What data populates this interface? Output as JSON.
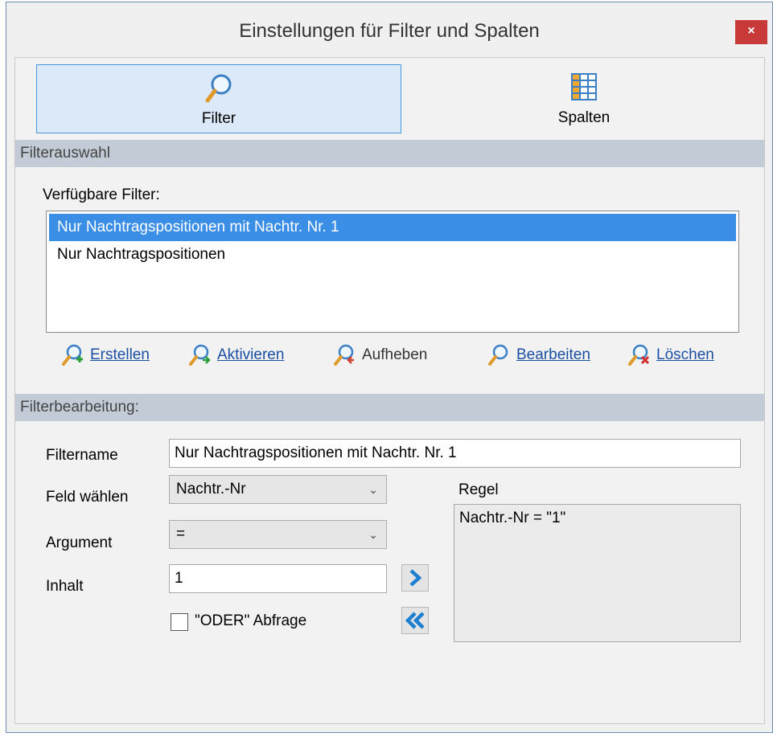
{
  "window": {
    "title": "Einstellungen für Filter und Spalten",
    "close_glyph": "×"
  },
  "tabs": [
    {
      "label": "Filter",
      "icon": "magnifier-icon",
      "active": true
    },
    {
      "label": "Spalten",
      "icon": "columns-grid-icon",
      "active": false
    }
  ],
  "filterauswahl": {
    "header": "Filterauswahl",
    "list_label": "Verfügbare Filter:",
    "items": [
      {
        "label": "Nur Nachtragspositionen mit Nachtr. Nr. 1",
        "selected": true
      },
      {
        "label": "Nur Nachtragspositionen",
        "selected": false
      }
    ],
    "actions": [
      {
        "label": "Erstellen",
        "icon": "filter-add-icon",
        "enabled": true
      },
      {
        "label": "Aktivieren",
        "icon": "filter-activate-icon",
        "enabled": true
      },
      {
        "label": "Aufheben",
        "icon": "filter-remove-icon",
        "enabled": false
      },
      {
        "label": "Bearbeiten",
        "icon": "filter-edit-icon",
        "enabled": true
      },
      {
        "label": "Löschen",
        "icon": "filter-delete-icon",
        "enabled": true
      }
    ]
  },
  "filterbearbeitung": {
    "header": "Filterbearbeitung:",
    "filtername_label": "Filtername",
    "filtername_value": "Nur Nachtragspositionen mit Nachtr. Nr. 1",
    "feld_label": "Feld wählen",
    "feld_value": "Nachtr.-Nr",
    "argument_label": "Argument",
    "argument_value": "=",
    "inhalt_label": "Inhalt",
    "inhalt_value": "1",
    "oder_label": "\"ODER\" Abfrage",
    "oder_checked": false,
    "regel_label": "Regel",
    "regel_text": "Nachtr.-Nr = \"1\"",
    "add_button": "chevron-right-icon",
    "remove_button": "double-chevron-left-icon"
  },
  "colors": {
    "accent": "#3a8ee6",
    "link": "#1a4fa3",
    "section": "#c3ccd6",
    "close": "#c83a3a"
  }
}
